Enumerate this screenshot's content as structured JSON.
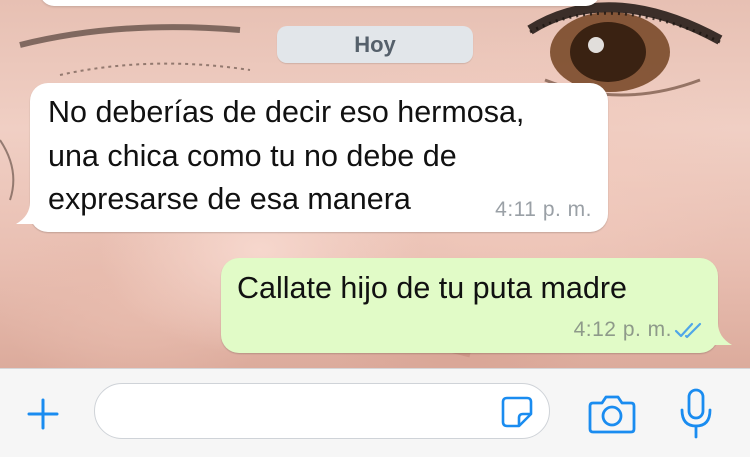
{
  "chat": {
    "date_separator": "Hoy",
    "messages": [
      {
        "direction": "incoming",
        "text": "No deberías de decir eso hermosa,\nuna chica como tu no debe de\nexpresarse de esa manera",
        "time": "4:11 p. m."
      },
      {
        "direction": "outgoing",
        "text": "Callate hijo de tu puta madre",
        "time": "4:12 p. m.",
        "status": "read"
      }
    ]
  },
  "input_bar": {
    "message_value": "",
    "icons": [
      "plus-icon",
      "sticker-icon",
      "camera-icon",
      "microphone-icon"
    ]
  },
  "colors": {
    "accent": "#1a8cf0",
    "incoming_bubble": "#ffffff",
    "outgoing_bubble": "#e1fbc7",
    "read_ticks": "#4fa6e8"
  }
}
